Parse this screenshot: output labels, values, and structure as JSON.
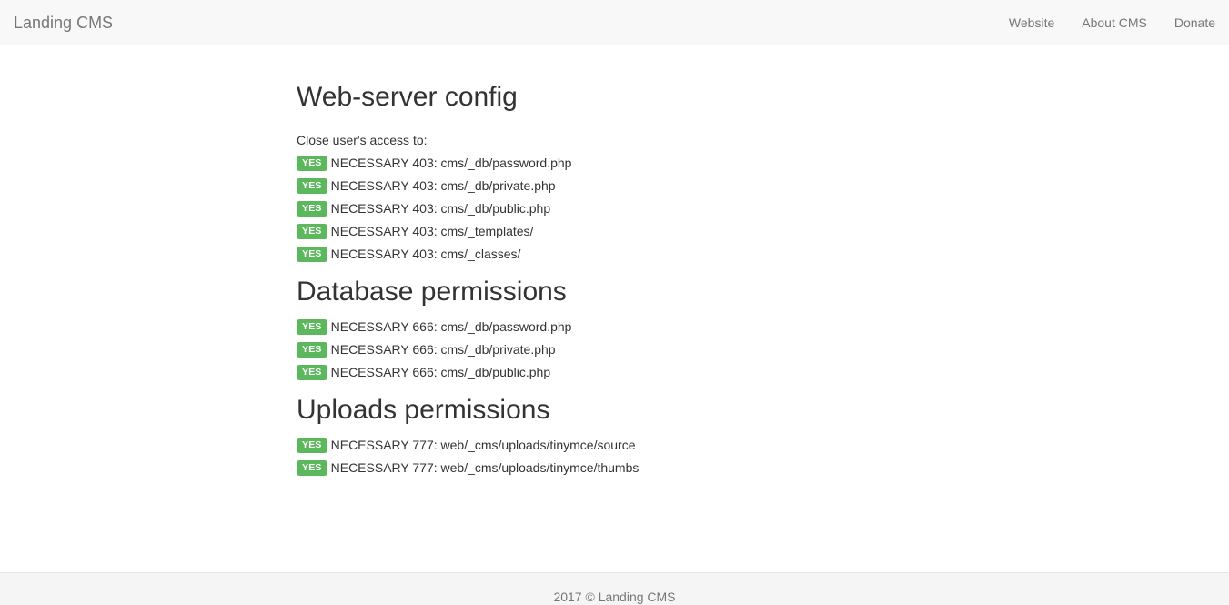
{
  "navbar": {
    "brand": "Landing CMS",
    "links": [
      "Website",
      "About CMS",
      "Donate"
    ]
  },
  "sections": {
    "web": {
      "title": "Web-server config",
      "intro": "Close user's access to:",
      "items": [
        {
          "badge": "YES",
          "text": "NECESSARY 403: cms/_db/password.php"
        },
        {
          "badge": "YES",
          "text": "NECESSARY 403: cms/_db/private.php"
        },
        {
          "badge": "YES",
          "text": "NECESSARY 403: cms/_db/public.php"
        },
        {
          "badge": "YES",
          "text": "NECESSARY 403: cms/_templates/"
        },
        {
          "badge": "YES",
          "text": "NECESSARY 403: cms/_classes/"
        }
      ]
    },
    "db": {
      "title": "Database permissions",
      "items": [
        {
          "badge": "YES",
          "text": "NECESSARY 666: cms/_db/password.php"
        },
        {
          "badge": "YES",
          "text": "NECESSARY 666: cms/_db/private.php"
        },
        {
          "badge": "YES",
          "text": "NECESSARY 666: cms/_db/public.php"
        }
      ]
    },
    "uploads": {
      "title": "Uploads permissions",
      "items": [
        {
          "badge": "YES",
          "text": "NECESSARY 777: web/_cms/uploads/tinymce/source"
        },
        {
          "badge": "YES",
          "text": "NECESSARY 777: web/_cms/uploads/tinymce/thumbs"
        }
      ]
    }
  },
  "footer": {
    "text": "2017 © Landing CMS"
  },
  "colors": {
    "success": "#5cb85c",
    "navbar_bg": "#f8f8f8",
    "footer_bg": "#f5f5f5",
    "muted_text": "#777777"
  }
}
